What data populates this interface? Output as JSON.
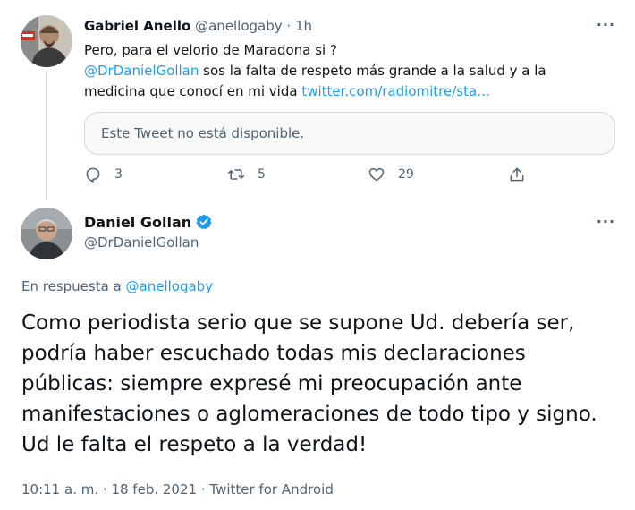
{
  "parent_tweet": {
    "author_name": "Gabriel Anello",
    "author_handle": "@anellogaby",
    "separator": "·",
    "time": "1h",
    "more": "···",
    "text_line1": "Pero, para el velorio de Maradona si ?",
    "mention": "@DrDanielGollan",
    "text_rest_line2": " sos la falta de respeto más grande a la salud y a la",
    "text_line3_start": "medicina que conocí en mi vida ",
    "link": "twitter.com/radiomitre/sta…",
    "quoted_unavailable": "Este Tweet no está disponible.",
    "actions": {
      "replies": "3",
      "retweets": "5",
      "likes": "29"
    }
  },
  "main_tweet": {
    "author_name": "Daniel Gollan",
    "author_handle": "@DrDanielGollan",
    "verified": true,
    "more": "···",
    "reply_prefix": "En respuesta a ",
    "reply_to": "@anellogaby",
    "text_lines": [
      "Como periodista serio que se supone Ud. debería ser,",
      "podría haber escuchado todas mis declaraciones",
      "públicas: siempre expresé mi preocupación ante",
      "manifestaciones o aglomeraciones de todo tipo y signo.",
      "Ud le falta el respeto a la verdad!"
    ],
    "time": "10:11 a. m.",
    "date": "18 feb. 2021",
    "separator": "·",
    "source": "Twitter for Android"
  },
  "colors": {
    "accent": "#1d9bf0",
    "text": "#0f1419",
    "muted": "#536471",
    "border": "#cfd9de"
  },
  "icons": {
    "reply": "reply-icon",
    "retweet": "retweet-icon",
    "like": "heart-icon",
    "share": "share-icon",
    "verified": "verified-badge-icon",
    "more": "more-icon"
  }
}
